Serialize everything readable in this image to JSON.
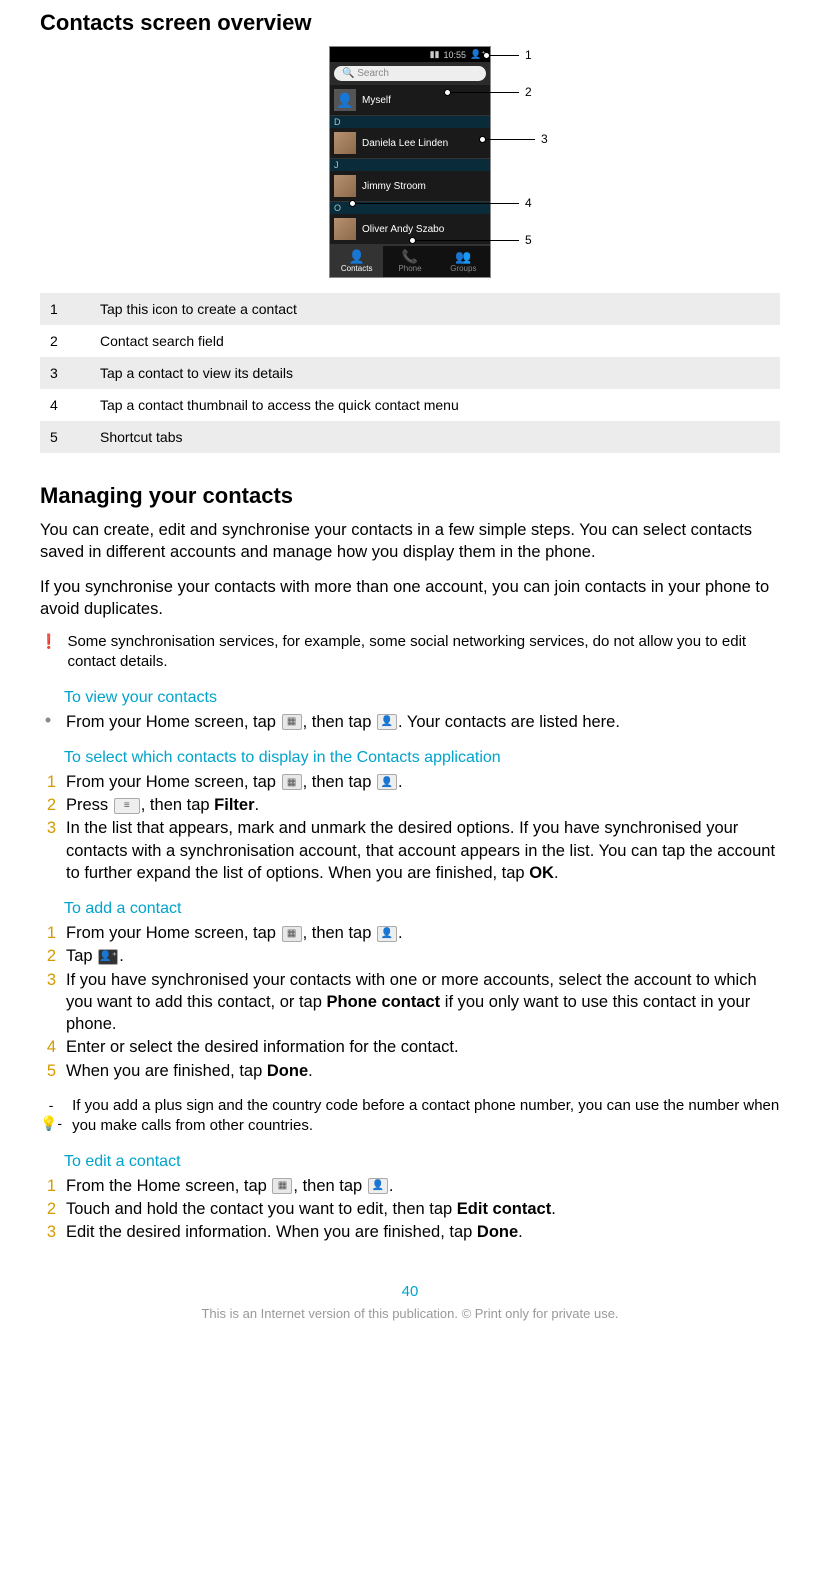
{
  "title1": "Contacts screen overview",
  "phone": {
    "time": "10:55",
    "search_placeholder": "Search",
    "self_label": "Myself",
    "sections": [
      {
        "letter": "D",
        "name": "Daniela Lee Linden"
      },
      {
        "letter": "J",
        "name": "Jimmy Stroom"
      },
      {
        "letter": "O",
        "name": "Oliver Andy Szabo"
      }
    ],
    "tabs": [
      "Contacts",
      "Phone",
      "Groups"
    ]
  },
  "callouts": [
    "1",
    "2",
    "3",
    "4",
    "5"
  ],
  "legend": [
    {
      "num": "1",
      "text": "Tap this icon to create a contact"
    },
    {
      "num": "2",
      "text": "Contact search field"
    },
    {
      "num": "3",
      "text": "Tap a contact to view its details"
    },
    {
      "num": "4",
      "text": "Tap a contact thumbnail to access the quick contact menu"
    },
    {
      "num": "5",
      "text": "Shortcut tabs"
    }
  ],
  "title2": "Managing your contacts",
  "para1": "You can create, edit and synchronise your contacts in a few simple steps. You can select contacts saved in different accounts and manage how you display them in the phone.",
  "para2": "If you synchronise your contacts with more than one account, you can join contacts in your phone to avoid duplicates.",
  "warn1": "Some synchronisation services, for example, some social networking services, do not allow you to edit contact details.",
  "sub1": "To view your contacts",
  "view_step": {
    "pre": "From your Home screen, tap ",
    "mid": ", then tap ",
    "post": ". Your contacts are listed here."
  },
  "sub2": "To select which contacts to display in the Contacts application",
  "select_steps": {
    "s1_pre": "From your Home screen, tap ",
    "s1_mid": ", then tap ",
    "s1_post": ".",
    "s2_pre": "Press ",
    "s2_mid": ", then tap ",
    "s2_bold": "Filter",
    "s2_post": ".",
    "s3_pre": "In the list that appears, mark and unmark the desired options. If you have synchronised your contacts with a synchronisation account, that account appears in the list. You can tap the account to further expand the list of options. When you are finished, tap ",
    "s3_bold": "OK",
    "s3_post": "."
  },
  "sub3": "To add a contact",
  "add_steps": {
    "s1_pre": "From your Home screen, tap ",
    "s1_mid": ", then tap ",
    "s1_post": ".",
    "s2_pre": "Tap ",
    "s2_post": ".",
    "s3_pre": "If you have synchronised your contacts with one or more accounts, select the account to which you want to add this contact, or tap ",
    "s3_bold": "Phone contact",
    "s3_post": " if you only want to use this contact in your phone.",
    "s4": "Enter or select the desired information for the contact.",
    "s5_pre": "When you are finished, tap ",
    "s5_bold": "Done",
    "s5_post": "."
  },
  "tip1": "If you add a plus sign and the country code before a contact phone number, you can use the number when you make calls from other countries.",
  "sub4": "To edit a contact",
  "edit_steps": {
    "s1_pre": "From the Home screen, tap ",
    "s1_mid": ", then tap ",
    "s1_post": ".",
    "s2_pre": "Touch and hold the contact you want to edit, then tap ",
    "s2_bold": "Edit contact",
    "s2_post": ".",
    "s3_pre": "Edit the desired information. When you are finished, tap ",
    "s3_bold": "Done",
    "s3_post": "."
  },
  "page_number": "40",
  "footer": "This is an Internet version of this publication. © Print only for private use."
}
